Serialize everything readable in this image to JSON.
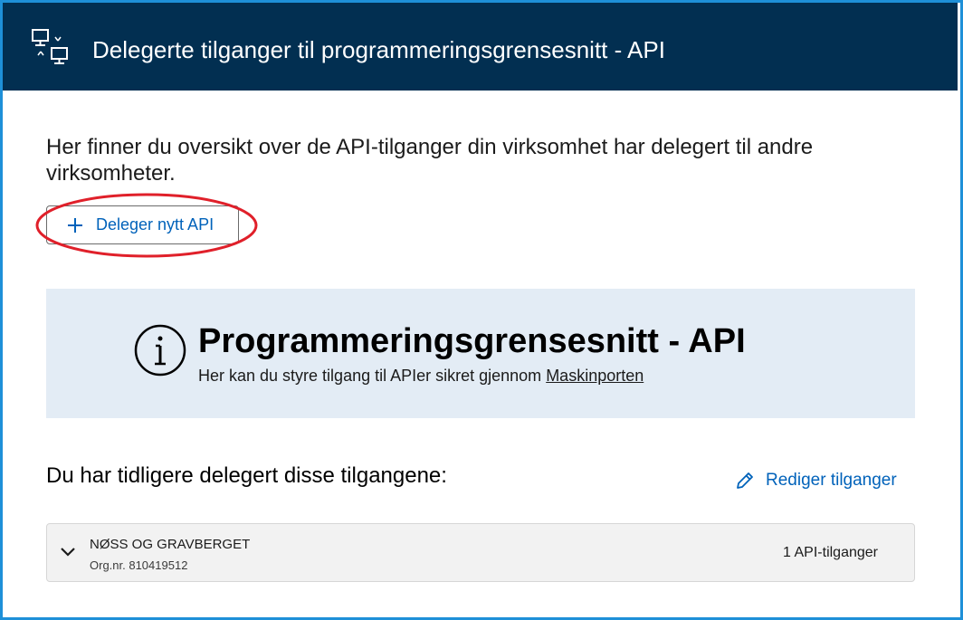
{
  "header": {
    "title": "Delegerte tilganger til programmeringsgrensesnitt - API",
    "icon": "api-computers-icon",
    "background": "#022f51"
  },
  "intro": {
    "text": "Her finner du oversikt over de API-tilganger din virksomhet har delegert til andre virksomheter."
  },
  "delegate_button": {
    "label": "Deleger nytt API",
    "icon": "plus-icon"
  },
  "info_panel": {
    "icon": "info-icon",
    "title": "Programmeringsgrensesnitt - API",
    "description": "Her kan du styre tilgang til APIer sikret gjennom ",
    "link_text": "Maskinporten",
    "background": "#e3ecf5"
  },
  "delegations": {
    "title": "Du har tidligere delegert disse tilgangene:",
    "edit_label": "Rediger tilganger",
    "edit_icon": "pencil-icon",
    "organizations": [
      {
        "name": "NØSS OG GRAVBERGET",
        "org_nr": "Org.nr. 810419512",
        "count": "1 API-tilganger"
      }
    ]
  },
  "colors": {
    "accent": "#0062ba",
    "annotation": "#e0202a",
    "frame": "#1e90d8"
  }
}
